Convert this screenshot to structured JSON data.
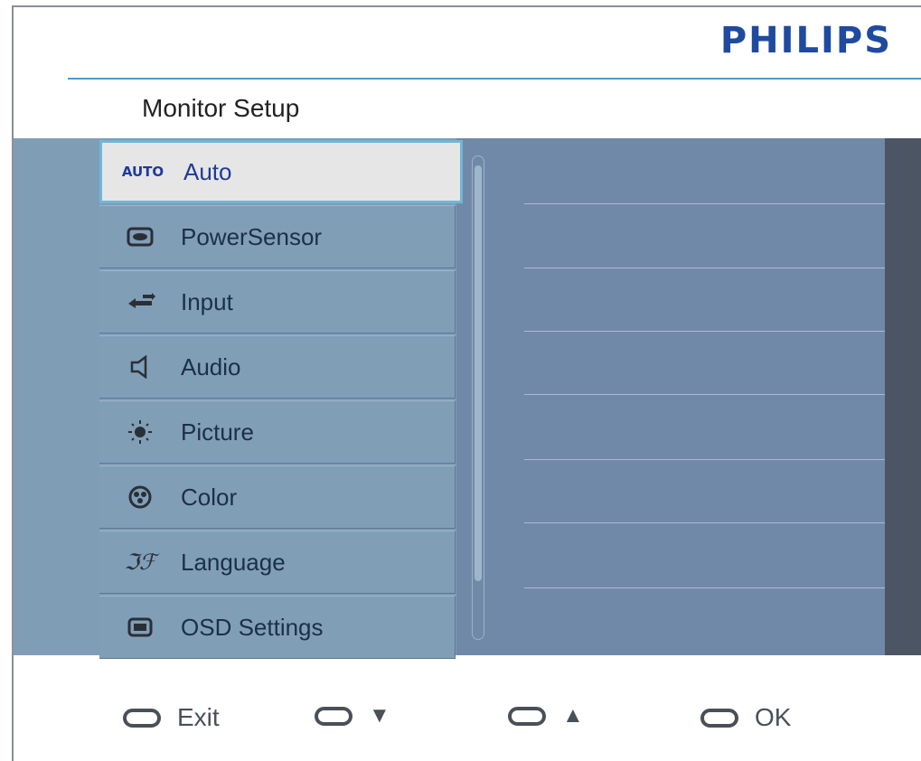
{
  "brand": "PHILIPS",
  "title": "Monitor Setup",
  "menu": [
    {
      "label": "Auto",
      "icon": "auto-icon",
      "icon_text": "AUTO",
      "selected": true
    },
    {
      "label": "PowerSensor",
      "icon": "eye-icon"
    },
    {
      "label": "Input",
      "icon": "input-icon"
    },
    {
      "label": "Audio",
      "icon": "speaker-icon"
    },
    {
      "label": "Picture",
      "icon": "brightness-icon"
    },
    {
      "label": "Color",
      "icon": "color-palette-icon"
    },
    {
      "label": "Language",
      "icon": "language-icon"
    },
    {
      "label": "OSD Settings",
      "icon": "osd-icon"
    }
  ],
  "footer": {
    "exit_label": "Exit",
    "down_label": "▼",
    "up_label": "▲",
    "ok_label": "OK"
  },
  "colors": {
    "brand": "#1f4aa0",
    "accent_line": "#4a9ad0",
    "panel": "#809db6",
    "selected_bg": "#e6e6e6",
    "selected_border": "#6fb7d8",
    "right_area": "#7189a8",
    "dark_strip": "#4c5564"
  }
}
